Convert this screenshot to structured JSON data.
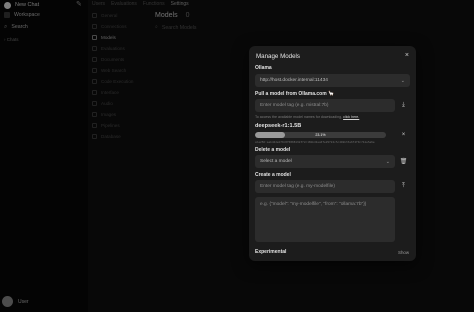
{
  "sidebar": {
    "new_chat": "New Chat",
    "workspace": "Workspace",
    "search": "Search",
    "chats": "Chats",
    "user": "User"
  },
  "topbar": {
    "tabs": [
      "Users",
      "Evaluations",
      "Functions",
      "Settings"
    ]
  },
  "settings_nav": [
    "General",
    "Connections",
    "Models",
    "Evaluations",
    "Documents",
    "Web Search",
    "Code Execution",
    "Interface",
    "Audio",
    "Images",
    "Pipelines",
    "Database"
  ],
  "models_header": {
    "title": "Models",
    "count": "0"
  },
  "search_models_placeholder": "Search Models",
  "modal": {
    "title": "Manage Models",
    "ollama_label": "Ollama",
    "ollama_url": "http://host.docker.internal:11434",
    "pull_label": "Pull a model from Ollama.com",
    "pull_placeholder": "Enter model tag (e.g. mistral:7b)",
    "hint_text": "To access the available model names for downloading,",
    "hint_link": "click here.",
    "pull_model_name": "deepseek-r1:1.5B",
    "progress_percent": 23,
    "progress_label": "23.1%",
    "digest": "sha256:aabd4debf0c8f08881923f2c18bbd2aa0fe29f24c5c4b9b33a6f4f0c7b1e5a6e",
    "delete_label": "Delete a model",
    "select_placeholder": "Select a model",
    "create_label": "Create a model",
    "create_placeholder": "Enter model tag (e.g. my-modelfile)",
    "modelfile_placeholder": "e.g. {\"model\": \"my-modelfile\", \"from\": \"ollama:7b\"})",
    "experimental_label": "Experimental",
    "show_label": "Show"
  },
  "icons": {
    "close": "close-icon",
    "download": "download-icon",
    "trash": "trash-icon",
    "upload": "upload-icon"
  }
}
